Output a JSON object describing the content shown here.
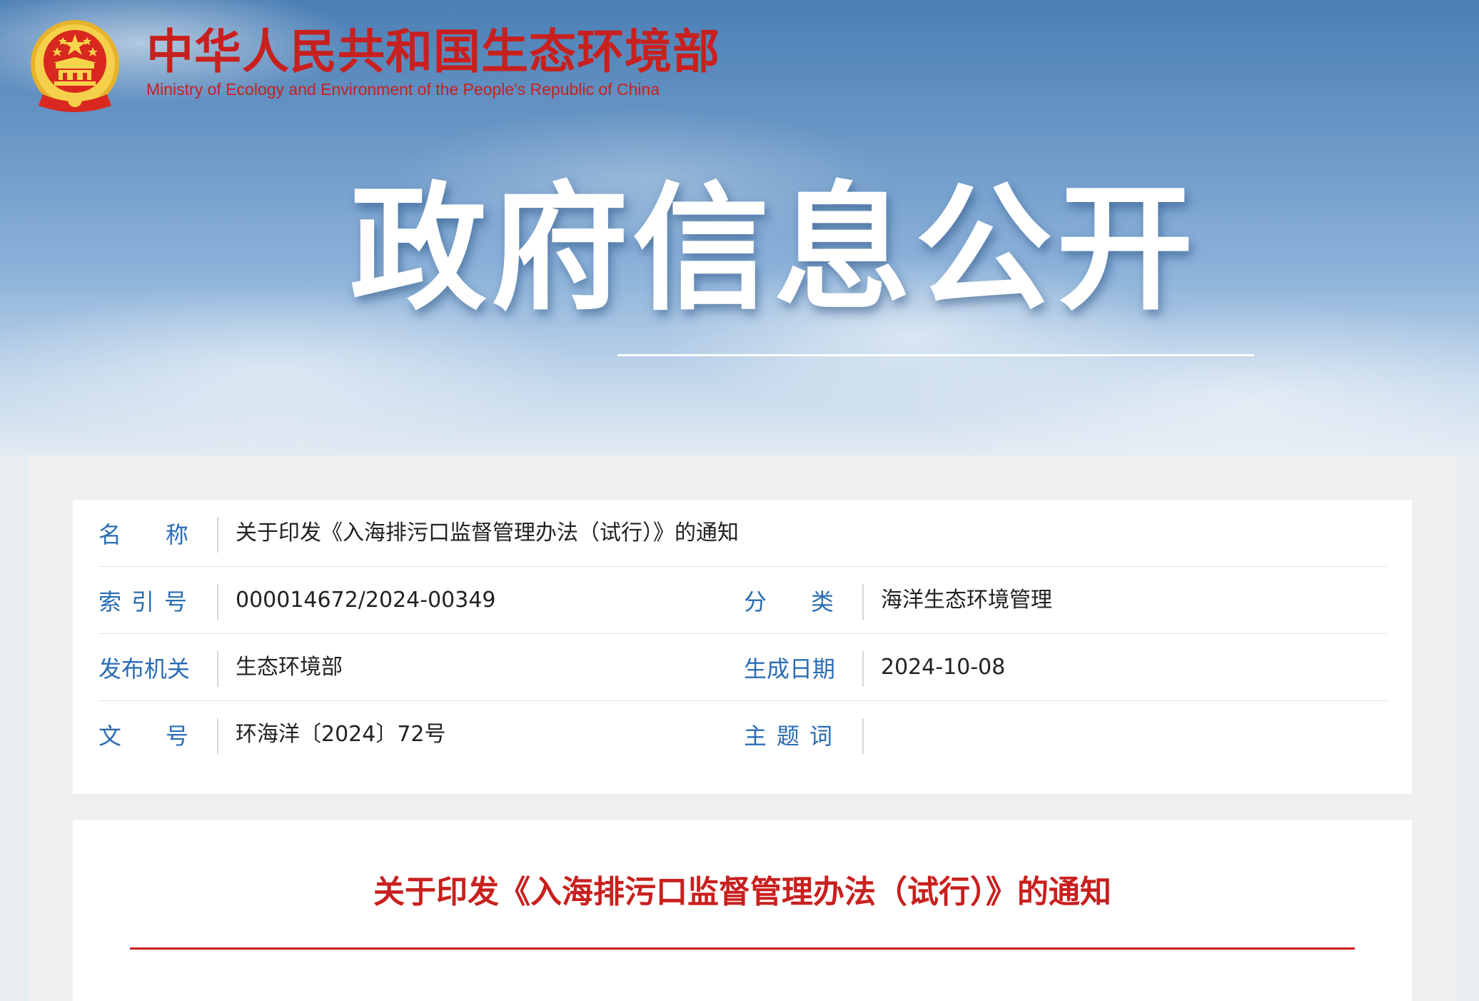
{
  "header": {
    "site_title": "中华人民共和国生态环境部",
    "site_subtitle": "Ministry of Ecology and Environment of the People's Republic of China",
    "hero_title": "政府信息公开"
  },
  "meta": {
    "name": {
      "label": "名称",
      "value": "关于印发《入海排污口监督管理办法（试行）》的通知"
    },
    "index": {
      "label": "索引号",
      "value": "000014672/2024-00349"
    },
    "category": {
      "label": "分类",
      "value": "海洋生态环境管理"
    },
    "publisher": {
      "label": "发布机关",
      "value": "生态环境部"
    },
    "date": {
      "label": "生成日期",
      "value": "2024-10-08"
    },
    "doc_number": {
      "label": "文号",
      "value": "环海洋〔2024〕72号"
    },
    "keywords": {
      "label": "主题词",
      "value": ""
    }
  },
  "article": {
    "title": "关于印发《入海排污口监督管理办法（试行）》的通知"
  },
  "colors": {
    "brand_red": "#c8201e",
    "label_blue": "#2a6db5",
    "emblem_gold": "#f2c12e"
  },
  "icons": {
    "emblem": "national-emblem-icon"
  }
}
